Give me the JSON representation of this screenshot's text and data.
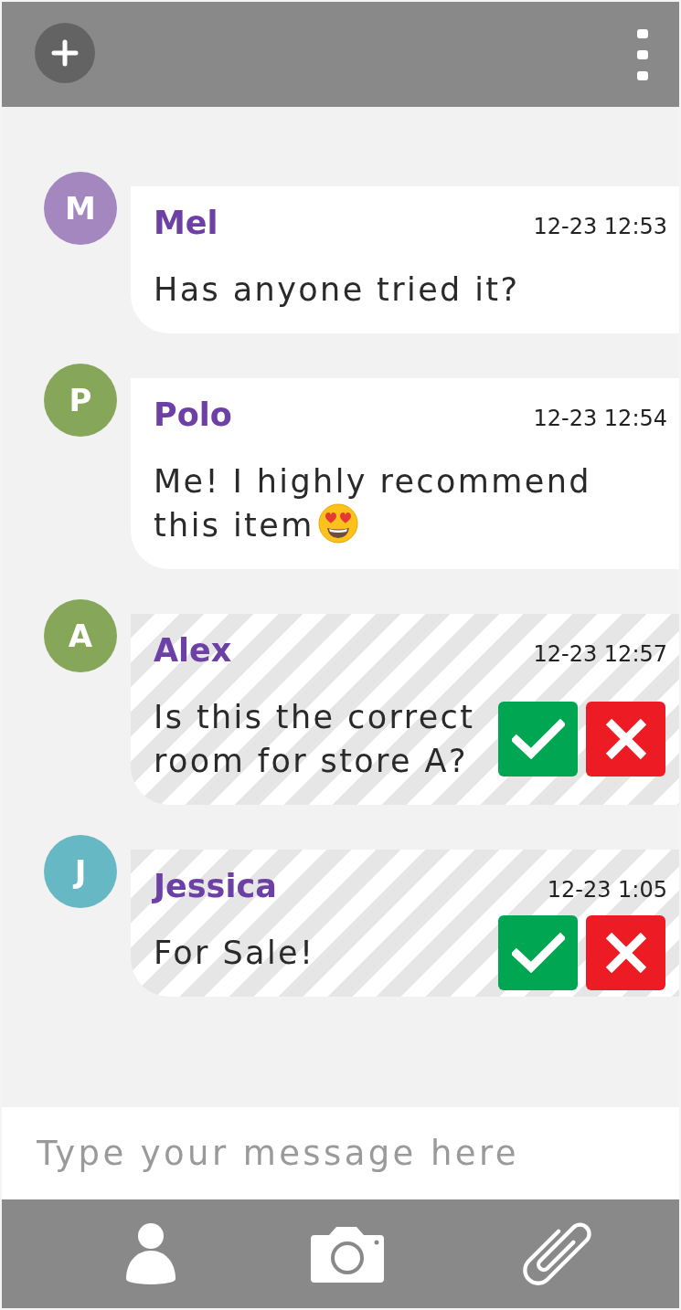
{
  "messages": [
    {
      "sender": "Mel",
      "initial": "M",
      "color": "#a387be",
      "time": "12-23 12:53",
      "lines": [
        "Has anyone tried it?"
      ],
      "emoji": false,
      "pending": false
    },
    {
      "sender": "Polo",
      "initial": "P",
      "color": "#86a75a",
      "time": "12-23 12:54",
      "lines": [
        "Me! I highly recommend",
        "this item"
      ],
      "emoji": true,
      "pending": false
    },
    {
      "sender": "Alex",
      "initial": "A",
      "color": "#86a75a",
      "time": "12-23 12:57",
      "lines": [
        "Is this the correct",
        "room for store A?"
      ],
      "emoji": false,
      "pending": true
    },
    {
      "sender": "Jessica",
      "initial": "J",
      "color": "#66b9c4",
      "time": "12-23 1:05",
      "lines": [
        "For Sale!"
      ],
      "emoji": false,
      "pending": true
    }
  ],
  "composer": {
    "placeholder": "Type your message here"
  }
}
